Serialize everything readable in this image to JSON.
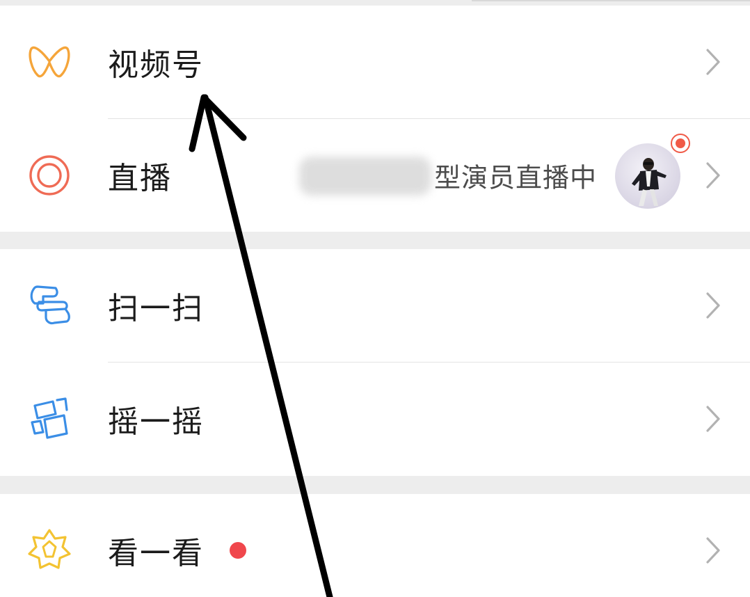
{
  "menu": {
    "channels": {
      "label": "视频号",
      "icon": "channels-butterfly-icon",
      "color": "#f5a53a"
    },
    "live": {
      "label": "直播",
      "icon": "live-target-icon",
      "color": "#ef6b55",
      "status_text": "型演员直播中"
    },
    "scan": {
      "label": "扫一扫",
      "icon": "scan-icon",
      "color": "#3b8ee6"
    },
    "shake": {
      "label": "摇一摇",
      "icon": "shake-icon",
      "color": "#3b8ee6"
    },
    "top_stories": {
      "label": "看一看",
      "icon": "top-stories-icon",
      "color": "#f3c332",
      "badge_color": "#f0474c"
    }
  },
  "annotation": {
    "icon": "black-arrow-annotation",
    "color": "#000000"
  }
}
